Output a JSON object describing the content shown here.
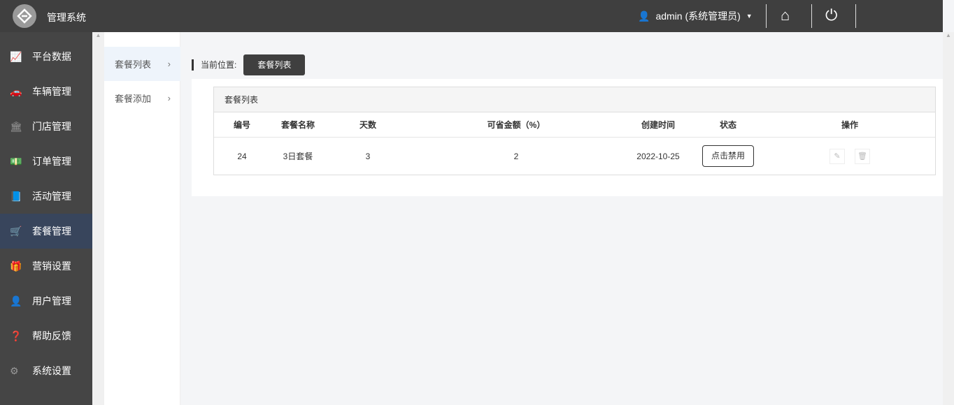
{
  "header": {
    "title": "管理系统",
    "user": "admin (系统管理员)"
  },
  "sidebar": {
    "items": [
      {
        "label": "平台数据",
        "icon": "chart-line-icon"
      },
      {
        "label": "车辆管理",
        "icon": "car-icon"
      },
      {
        "label": "门店管理",
        "icon": "bank-icon"
      },
      {
        "label": "订单管理",
        "icon": "money-icon"
      },
      {
        "label": "活动管理",
        "icon": "book-icon"
      },
      {
        "label": "套餐管理",
        "icon": "cart-icon"
      },
      {
        "label": "营销设置",
        "icon": "gift-icon"
      },
      {
        "label": "用户管理",
        "icon": "user-icon"
      },
      {
        "label": "帮助反馈",
        "icon": "question-icon"
      },
      {
        "label": "系统设置",
        "icon": "gear-icon"
      }
    ]
  },
  "submenu": {
    "items": [
      {
        "label": "套餐列表"
      },
      {
        "label": "套餐添加"
      }
    ]
  },
  "breadcrumb": {
    "label": "当前位置:",
    "current": "套餐列表"
  },
  "table": {
    "title": "套餐列表",
    "columns": [
      "编号",
      "套餐名称",
      "天数",
      "可省金额（%）",
      "创建时间",
      "状态",
      "操作"
    ],
    "rows": [
      {
        "id": "24",
        "name": "3日套餐",
        "days": "3",
        "save": "2",
        "created": "2022-10-25",
        "status_button": "点击禁用"
      }
    ]
  }
}
